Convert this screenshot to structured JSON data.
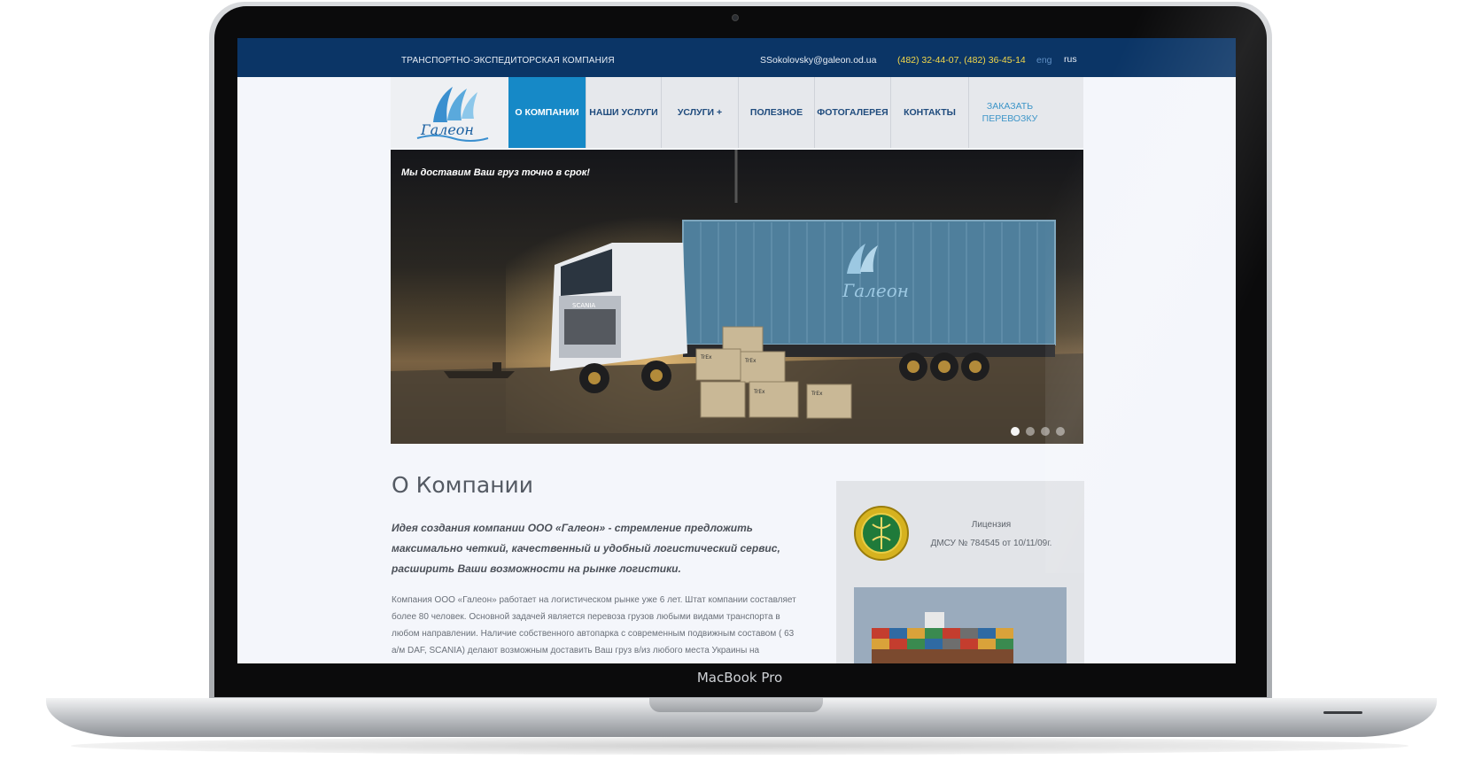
{
  "device": {
    "brand_label": "MacBook Pro"
  },
  "topbar": {
    "tagline": "ТРАНСПОРТНО-ЭКСПЕДИТОРСКАЯ КОМПАНИЯ",
    "email": "SSokolovsky@galeon.od.ua",
    "phone": "(482) 32-44-07, (482) 36-45-14",
    "languages": [
      "eng",
      "rus"
    ]
  },
  "nav": {
    "logo_text": "Галеон",
    "items": [
      {
        "label": "О КОМПАНИИ",
        "active": true
      },
      {
        "label": "НАШИ УСЛУГИ",
        "active": false
      },
      {
        "label": "УСЛУГИ +",
        "active": false
      },
      {
        "label": "ПОЛЕЗНОЕ",
        "active": false
      },
      {
        "label": "ФОТОГАЛЕРЕЯ",
        "active": false
      },
      {
        "label": "КОНТАКТЫ",
        "active": false
      }
    ],
    "order_label": "ЗАКАЗАТЬ ПЕРЕВОЗКУ"
  },
  "banner": {
    "caption": "Мы доставим Ваш груз точно в срок!",
    "truck_brand": "SCANIA",
    "container_logo": "Галеон",
    "box_label": "TrEx",
    "slide_count": 4,
    "active_slide": 1
  },
  "content": {
    "title": "О Компании",
    "lead": "Идея создания компании ООО «Галеон» - стремление предложить максимально четкий, качественный и удобный логистический сервис, расширить Ваши возможности на рынке логистики.",
    "body": "Компания ООО «Галеон» работает на логистическом рынке уже 6 лет. Штат компании составляет более 80 человек. Основной задачей является перевоза грузов любыми видами транспорта в любом направлении. Наличие собственного автопарка с современным подвижным составом ( 63 а/м DAF, SCANIA) делают возможным доставить  Ваш груз в/из любого места Украины на"
  },
  "sidebar": {
    "license_label": "Лицензия",
    "license_number": "ДМСУ № 784545 от 10/11/09г."
  },
  "colors": {
    "topbar": "#0b3566",
    "nav_active": "#1689c7",
    "phone": "#f3d84a"
  }
}
